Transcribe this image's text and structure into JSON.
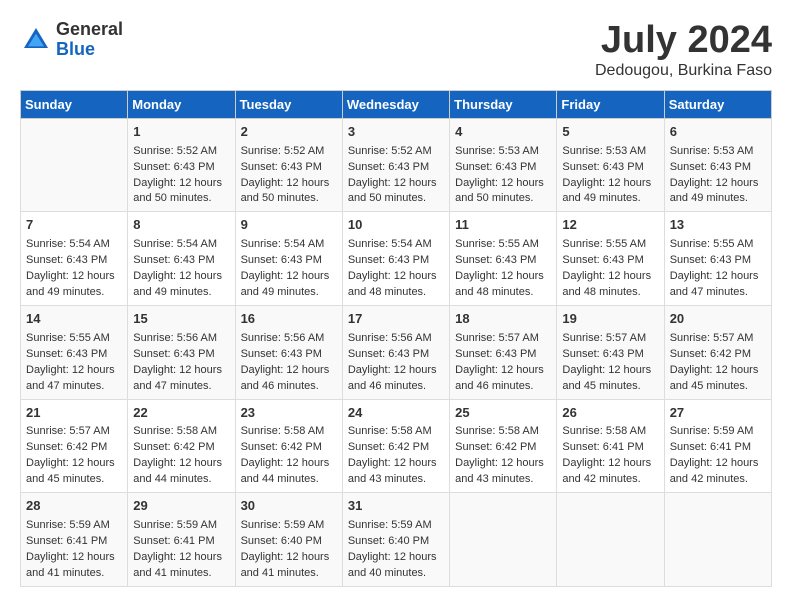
{
  "header": {
    "logo_general": "General",
    "logo_blue": "Blue",
    "month_title": "July 2024",
    "location": "Dedougou, Burkina Faso"
  },
  "days_of_week": [
    "Sunday",
    "Monday",
    "Tuesday",
    "Wednesday",
    "Thursday",
    "Friday",
    "Saturday"
  ],
  "weeks": [
    [
      {
        "day": "",
        "info": ""
      },
      {
        "day": "1",
        "info": "Sunrise: 5:52 AM\nSunset: 6:43 PM\nDaylight: 12 hours\nand 50 minutes."
      },
      {
        "day": "2",
        "info": "Sunrise: 5:52 AM\nSunset: 6:43 PM\nDaylight: 12 hours\nand 50 minutes."
      },
      {
        "day": "3",
        "info": "Sunrise: 5:52 AM\nSunset: 6:43 PM\nDaylight: 12 hours\nand 50 minutes."
      },
      {
        "day": "4",
        "info": "Sunrise: 5:53 AM\nSunset: 6:43 PM\nDaylight: 12 hours\nand 50 minutes."
      },
      {
        "day": "5",
        "info": "Sunrise: 5:53 AM\nSunset: 6:43 PM\nDaylight: 12 hours\nand 49 minutes."
      },
      {
        "day": "6",
        "info": "Sunrise: 5:53 AM\nSunset: 6:43 PM\nDaylight: 12 hours\nand 49 minutes."
      }
    ],
    [
      {
        "day": "7",
        "info": "Sunrise: 5:54 AM\nSunset: 6:43 PM\nDaylight: 12 hours\nand 49 minutes."
      },
      {
        "day": "8",
        "info": "Sunrise: 5:54 AM\nSunset: 6:43 PM\nDaylight: 12 hours\nand 49 minutes."
      },
      {
        "day": "9",
        "info": "Sunrise: 5:54 AM\nSunset: 6:43 PM\nDaylight: 12 hours\nand 49 minutes."
      },
      {
        "day": "10",
        "info": "Sunrise: 5:54 AM\nSunset: 6:43 PM\nDaylight: 12 hours\nand 48 minutes."
      },
      {
        "day": "11",
        "info": "Sunrise: 5:55 AM\nSunset: 6:43 PM\nDaylight: 12 hours\nand 48 minutes."
      },
      {
        "day": "12",
        "info": "Sunrise: 5:55 AM\nSunset: 6:43 PM\nDaylight: 12 hours\nand 48 minutes."
      },
      {
        "day": "13",
        "info": "Sunrise: 5:55 AM\nSunset: 6:43 PM\nDaylight: 12 hours\nand 47 minutes."
      }
    ],
    [
      {
        "day": "14",
        "info": "Sunrise: 5:55 AM\nSunset: 6:43 PM\nDaylight: 12 hours\nand 47 minutes."
      },
      {
        "day": "15",
        "info": "Sunrise: 5:56 AM\nSunset: 6:43 PM\nDaylight: 12 hours\nand 47 minutes."
      },
      {
        "day": "16",
        "info": "Sunrise: 5:56 AM\nSunset: 6:43 PM\nDaylight: 12 hours\nand 46 minutes."
      },
      {
        "day": "17",
        "info": "Sunrise: 5:56 AM\nSunset: 6:43 PM\nDaylight: 12 hours\nand 46 minutes."
      },
      {
        "day": "18",
        "info": "Sunrise: 5:57 AM\nSunset: 6:43 PM\nDaylight: 12 hours\nand 46 minutes."
      },
      {
        "day": "19",
        "info": "Sunrise: 5:57 AM\nSunset: 6:43 PM\nDaylight: 12 hours\nand 45 minutes."
      },
      {
        "day": "20",
        "info": "Sunrise: 5:57 AM\nSunset: 6:42 PM\nDaylight: 12 hours\nand 45 minutes."
      }
    ],
    [
      {
        "day": "21",
        "info": "Sunrise: 5:57 AM\nSunset: 6:42 PM\nDaylight: 12 hours\nand 45 minutes."
      },
      {
        "day": "22",
        "info": "Sunrise: 5:58 AM\nSunset: 6:42 PM\nDaylight: 12 hours\nand 44 minutes."
      },
      {
        "day": "23",
        "info": "Sunrise: 5:58 AM\nSunset: 6:42 PM\nDaylight: 12 hours\nand 44 minutes."
      },
      {
        "day": "24",
        "info": "Sunrise: 5:58 AM\nSunset: 6:42 PM\nDaylight: 12 hours\nand 43 minutes."
      },
      {
        "day": "25",
        "info": "Sunrise: 5:58 AM\nSunset: 6:42 PM\nDaylight: 12 hours\nand 43 minutes."
      },
      {
        "day": "26",
        "info": "Sunrise: 5:58 AM\nSunset: 6:41 PM\nDaylight: 12 hours\nand 42 minutes."
      },
      {
        "day": "27",
        "info": "Sunrise: 5:59 AM\nSunset: 6:41 PM\nDaylight: 12 hours\nand 42 minutes."
      }
    ],
    [
      {
        "day": "28",
        "info": "Sunrise: 5:59 AM\nSunset: 6:41 PM\nDaylight: 12 hours\nand 41 minutes."
      },
      {
        "day": "29",
        "info": "Sunrise: 5:59 AM\nSunset: 6:41 PM\nDaylight: 12 hours\nand 41 minutes."
      },
      {
        "day": "30",
        "info": "Sunrise: 5:59 AM\nSunset: 6:40 PM\nDaylight: 12 hours\nand 41 minutes."
      },
      {
        "day": "31",
        "info": "Sunrise: 5:59 AM\nSunset: 6:40 PM\nDaylight: 12 hours\nand 40 minutes."
      },
      {
        "day": "",
        "info": ""
      },
      {
        "day": "",
        "info": ""
      },
      {
        "day": "",
        "info": ""
      }
    ]
  ]
}
